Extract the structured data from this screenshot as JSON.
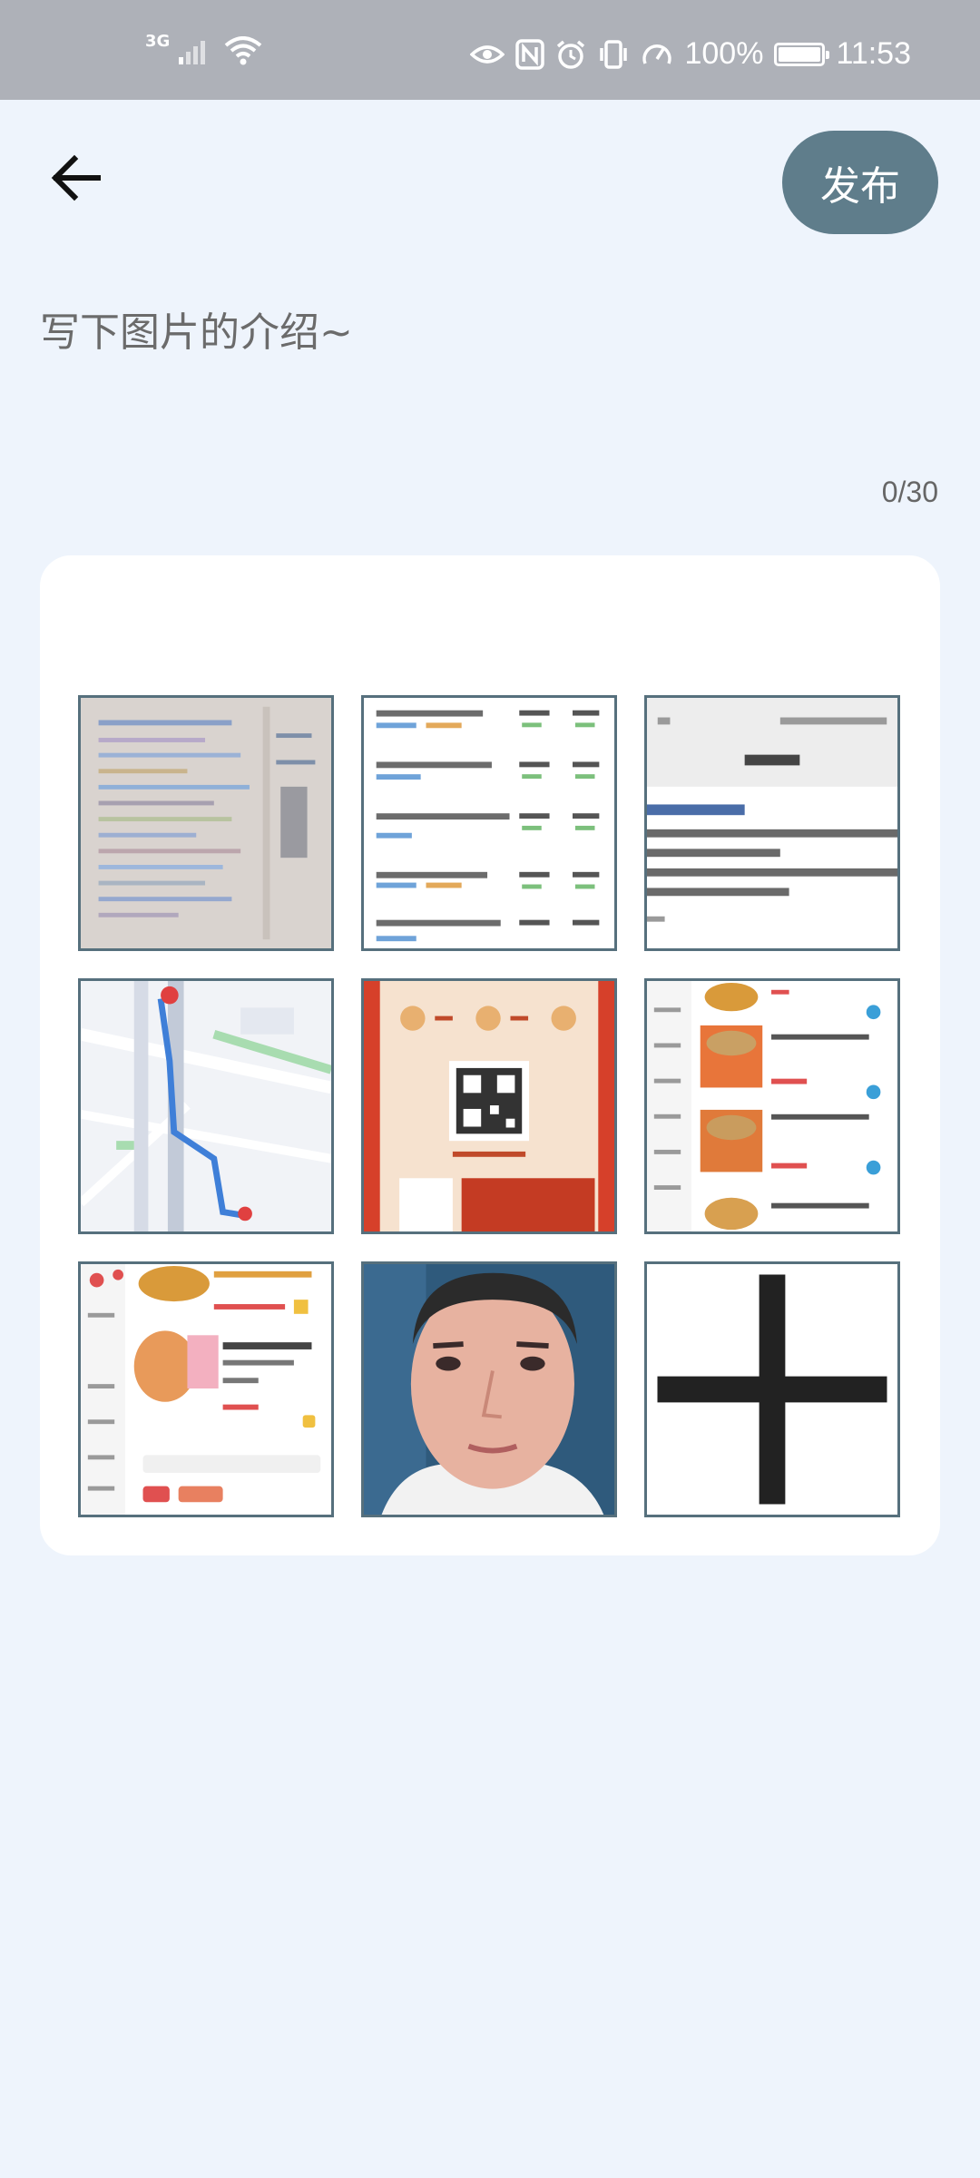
{
  "status_bar": {
    "network": "3G",
    "battery_percent": "100%",
    "time": "11:53"
  },
  "header": {
    "back_icon": "arrow-left-icon",
    "publish_label": "发布"
  },
  "description": {
    "placeholder": "写下图片的介绍~",
    "value": "",
    "char_count": "0/30"
  },
  "images": [
    {
      "name": "notebook-photo"
    },
    {
      "name": "list-screenshot"
    },
    {
      "name": "chat-screenshot"
    },
    {
      "name": "map-screenshot"
    },
    {
      "name": "red-poster-screenshot"
    },
    {
      "name": "food-menu-screenshot"
    },
    {
      "name": "food-order-screenshot"
    },
    {
      "name": "selfie-photo"
    }
  ],
  "add_icon": "plus-icon",
  "colors": {
    "background": "#eef4fc",
    "status_bar": "#aeb1b8",
    "publish_button": "#5f7d8b",
    "thumb_border": "#56707d"
  }
}
